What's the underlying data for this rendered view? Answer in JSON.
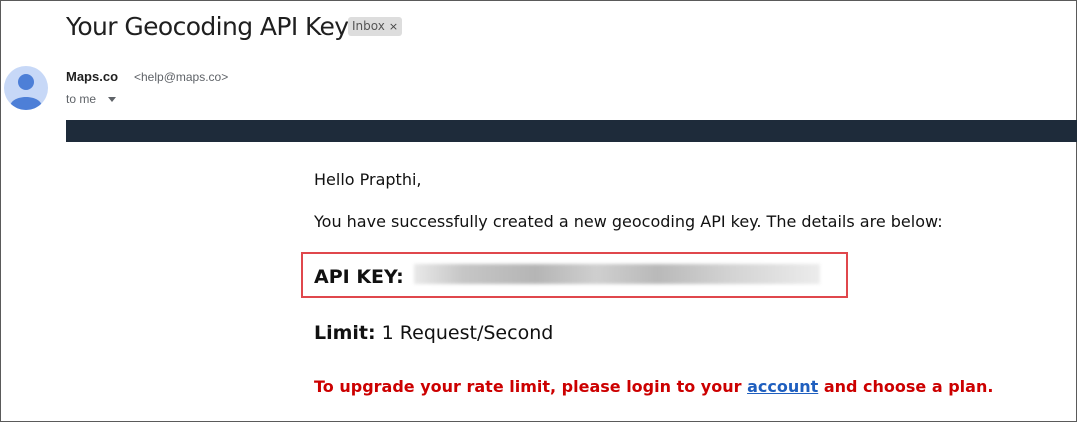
{
  "email": {
    "subject": "Your Geocoding API Key",
    "label": "Inbox",
    "label_close": "×",
    "sender": {
      "name": "Maps.co",
      "email": "<help@maps.co>",
      "recipient": "to me"
    },
    "body": {
      "greeting": "Hello Prapthi,",
      "intro": "You have successfully created a new geocoding API key. The details are below:",
      "api_key_label": "API KEY:",
      "limit_label": "Limit:",
      "limit_value": " 1 Request/Second",
      "upgrade_before": "To upgrade your rate limit, please login to your ",
      "upgrade_link": "account",
      "upgrade_after": " and choose a plan."
    }
  },
  "colors": {
    "banner": "#1e2b3a",
    "highlight_border": "#e0474c",
    "upgrade_text": "#cc0000",
    "link": "#1f5fbf"
  }
}
